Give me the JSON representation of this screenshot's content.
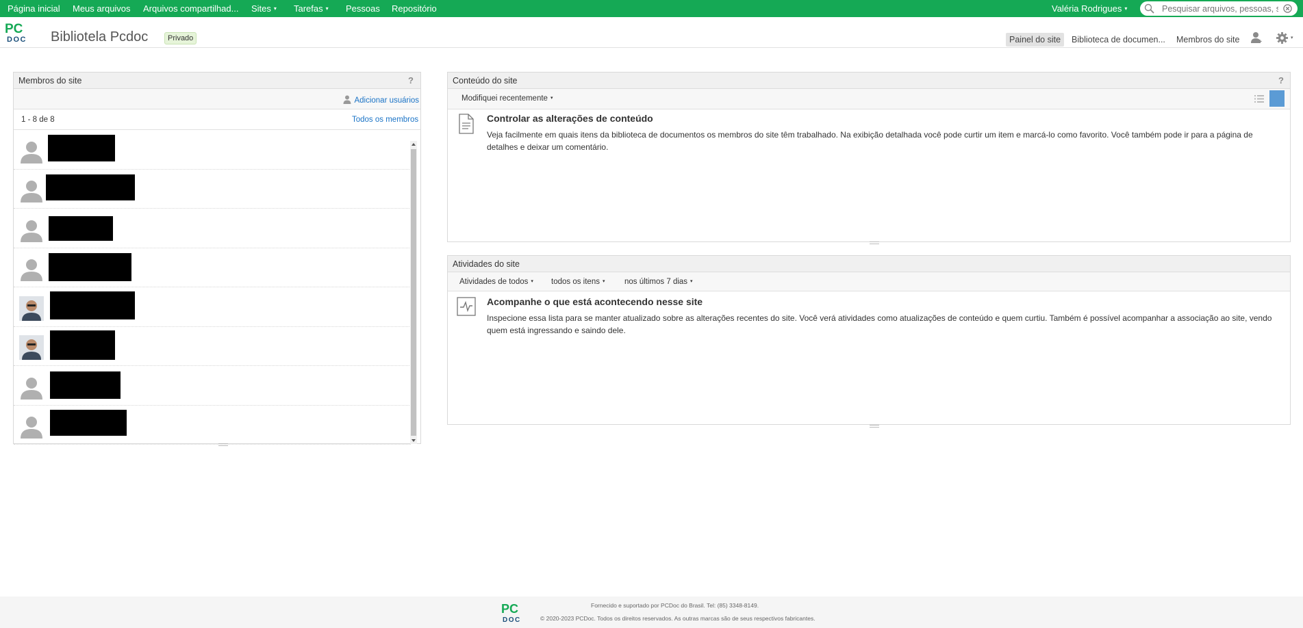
{
  "topnav": {
    "items": [
      {
        "label": "Página inicial"
      },
      {
        "label": "Meus arquivos"
      },
      {
        "label": "Arquivos compartilhad..."
      },
      {
        "label": "Sites",
        "caret": "▾"
      },
      {
        "label": "Tarefas",
        "caret": "▾"
      },
      {
        "label": "Pessoas"
      },
      {
        "label": "Repositório"
      }
    ],
    "user": "Valéria Rodrigues",
    "user_caret": "▾",
    "search_placeholder": "Pesquisar arquivos, pessoas, s"
  },
  "header": {
    "logo_top": "PC",
    "logo_bottom": "DOC",
    "site_title": "Bibliotela Pcdoc",
    "privacy_badge": "Privado",
    "links": [
      "Painel do site",
      "Biblioteca de documen...",
      "Membros do site"
    ],
    "active_link": "Painel do site",
    "user_icon": "add-user-icon",
    "settings_icon": "gear-icon",
    "settings_caret": "▾"
  },
  "members_dashlet": {
    "title": "Membros do site",
    "help": "?",
    "add_users": "Adicionar usuários",
    "count": "1 - 8 de 8",
    "all_members": "Todos os membros",
    "members": [
      {
        "avatar": "default"
      },
      {
        "avatar": "default"
      },
      {
        "avatar": "default"
      },
      {
        "avatar": "default"
      },
      {
        "avatar": "photo"
      },
      {
        "avatar": "photo"
      },
      {
        "avatar": "default"
      },
      {
        "avatar": "default"
      }
    ]
  },
  "content_dashlet": {
    "title": "Conteúdo do site",
    "help": "?",
    "filter": "Modifiquei recentemente",
    "filter_caret": "▾",
    "empty_title": "Controlar as alterações de conteúdo",
    "empty_text": "Veja facilmente em quais itens da biblioteca de documentos os membros do site têm trabalhado. Na exibição detalhada você pode curtir um item e marcá-lo como favorito. Você também pode ir para a página de detalhes e deixar um comentário.",
    "icon": "document-icon"
  },
  "activities_dashlet": {
    "title": "Atividades do site",
    "filters": [
      "Atividades de todos",
      "todos os itens",
      "nos últimos 7 dias"
    ],
    "caret": "▾",
    "empty_title": "Acompanhe o que está acontecendo nesse site",
    "empty_text": "Inspecione essa lista para se manter atualizado sobre as alterações recentes do site. Você verá atividades como atualizações de conteúdo e quem curtiu. Também é possível acompanhar a associação ao site, vendo quem está ingressando e saindo dele.",
    "icon": "activity-icon"
  },
  "footer": {
    "logo_top": "PC",
    "logo_bottom": "DOC",
    "supported": "Fornecido e suportado por PCDoc do Brasil. Tel: (85) 3348-8149.",
    "copyright": "© 2020-2023 PCDoc. Todos os direitos reservados. As outras marcas são de seus respectivos fabricantes."
  },
  "colors": {
    "nav_green": "#15a955",
    "link_blue": "#1a73c6",
    "logo_green": "#15a955",
    "logo_dark": "#1b4f7a"
  }
}
